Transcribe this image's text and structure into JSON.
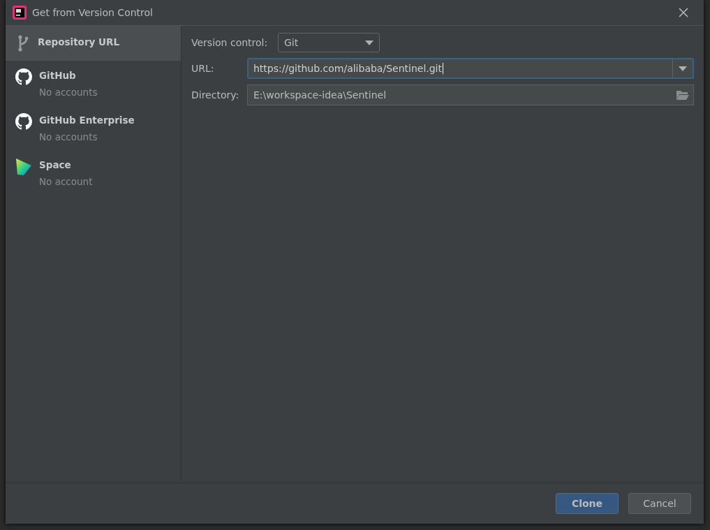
{
  "window": {
    "title": "Get from Version Control"
  },
  "sidebar": {
    "items": [
      {
        "kind": "branch",
        "label": "Repository URL",
        "selected": true
      },
      {
        "kind": "github",
        "label": "GitHub",
        "subtitle": "No accounts",
        "selected": false
      },
      {
        "kind": "github",
        "label": "GitHub Enterprise",
        "subtitle": "No accounts",
        "selected": false
      },
      {
        "kind": "space",
        "label": "Space",
        "subtitle": "No account",
        "selected": false
      }
    ]
  },
  "form": {
    "version_control": {
      "label": "Version control:",
      "value": "Git"
    },
    "url": {
      "label": "URL:",
      "value": "https://github.com/alibaba/Sentinel.git",
      "focused": true
    },
    "directory": {
      "label": "Directory:",
      "value": "E:\\workspace-idea\\Sentinel"
    }
  },
  "buttons": [
    {
      "label": "Clone",
      "kind": "primary"
    },
    {
      "label": "Cancel",
      "kind": "secondary"
    }
  ]
}
